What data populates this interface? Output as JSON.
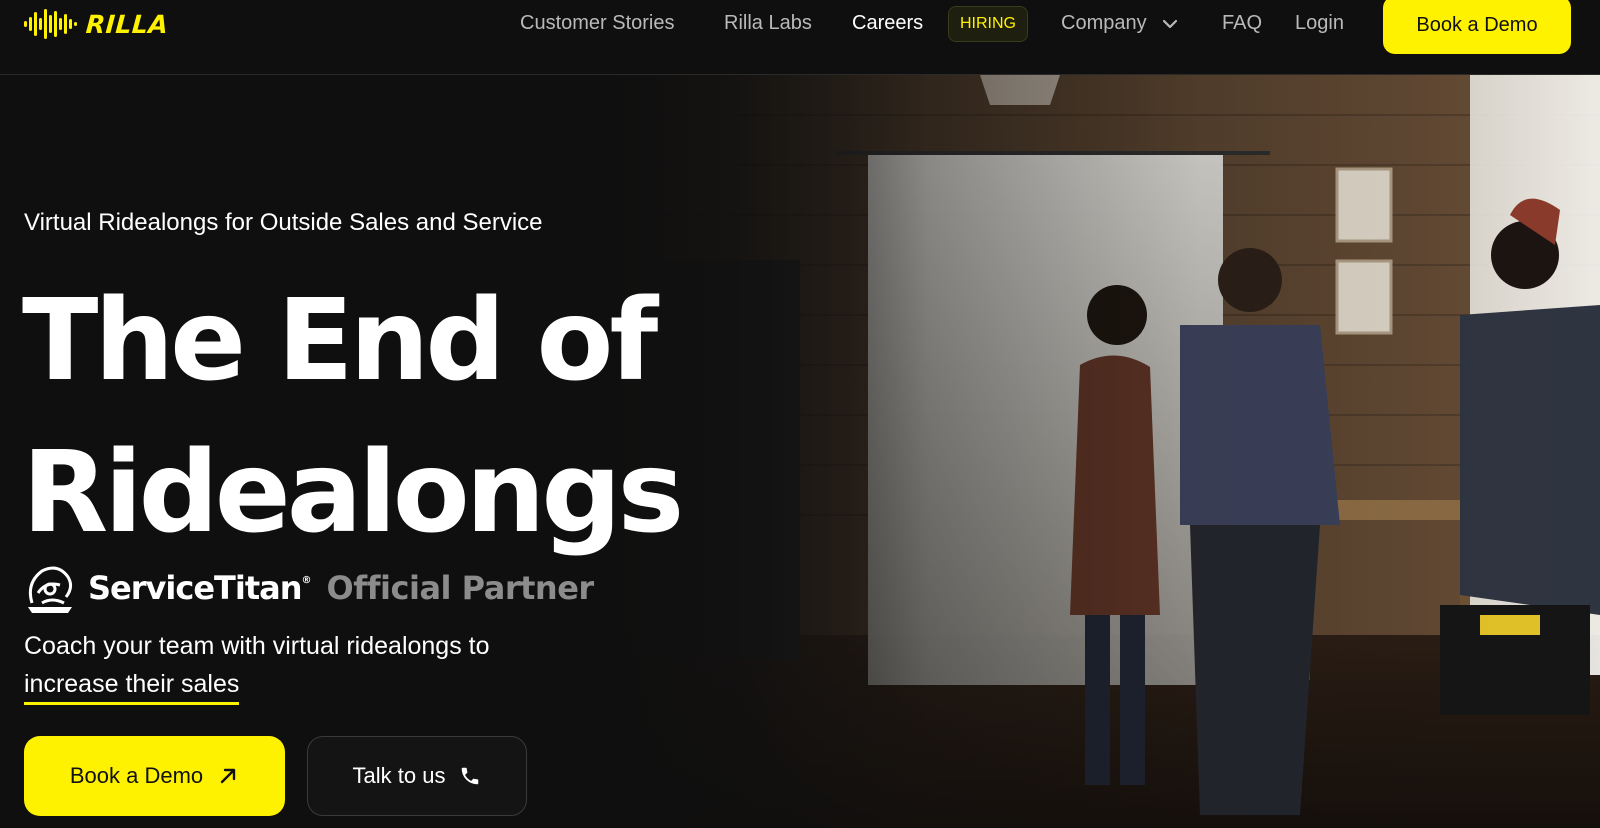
{
  "brand": {
    "name": "RILLA",
    "accent": "#fff200"
  },
  "nav": {
    "links": [
      {
        "label": "Customer Stories"
      },
      {
        "label": "Rilla Labs"
      },
      {
        "label": "Careers"
      },
      {
        "label": "Company"
      },
      {
        "label": "FAQ"
      },
      {
        "label": "Login"
      }
    ],
    "hiring_badge": "HIRING",
    "cta": "Book a Demo"
  },
  "hero": {
    "eyebrow": "Virtual Ridealongs for Outside Sales and Service",
    "headline_line1": "The End of",
    "headline_line2": "Ridealongs",
    "partner_brand": "ServiceTitan",
    "partner_tag": "Official Partner",
    "sub_line1": "Coach your team with virtual ridealongs to",
    "sub_highlight": "increase their sales",
    "primary_button": "Book a Demo",
    "secondary_button": "Talk to us"
  },
  "icons": {
    "logo": "sound-wave-logo-icon",
    "dropdown": "chevron-down-icon",
    "arrow": "arrow-up-right-icon",
    "phone": "phone-icon",
    "partner": "titan-mascot-icon"
  }
}
